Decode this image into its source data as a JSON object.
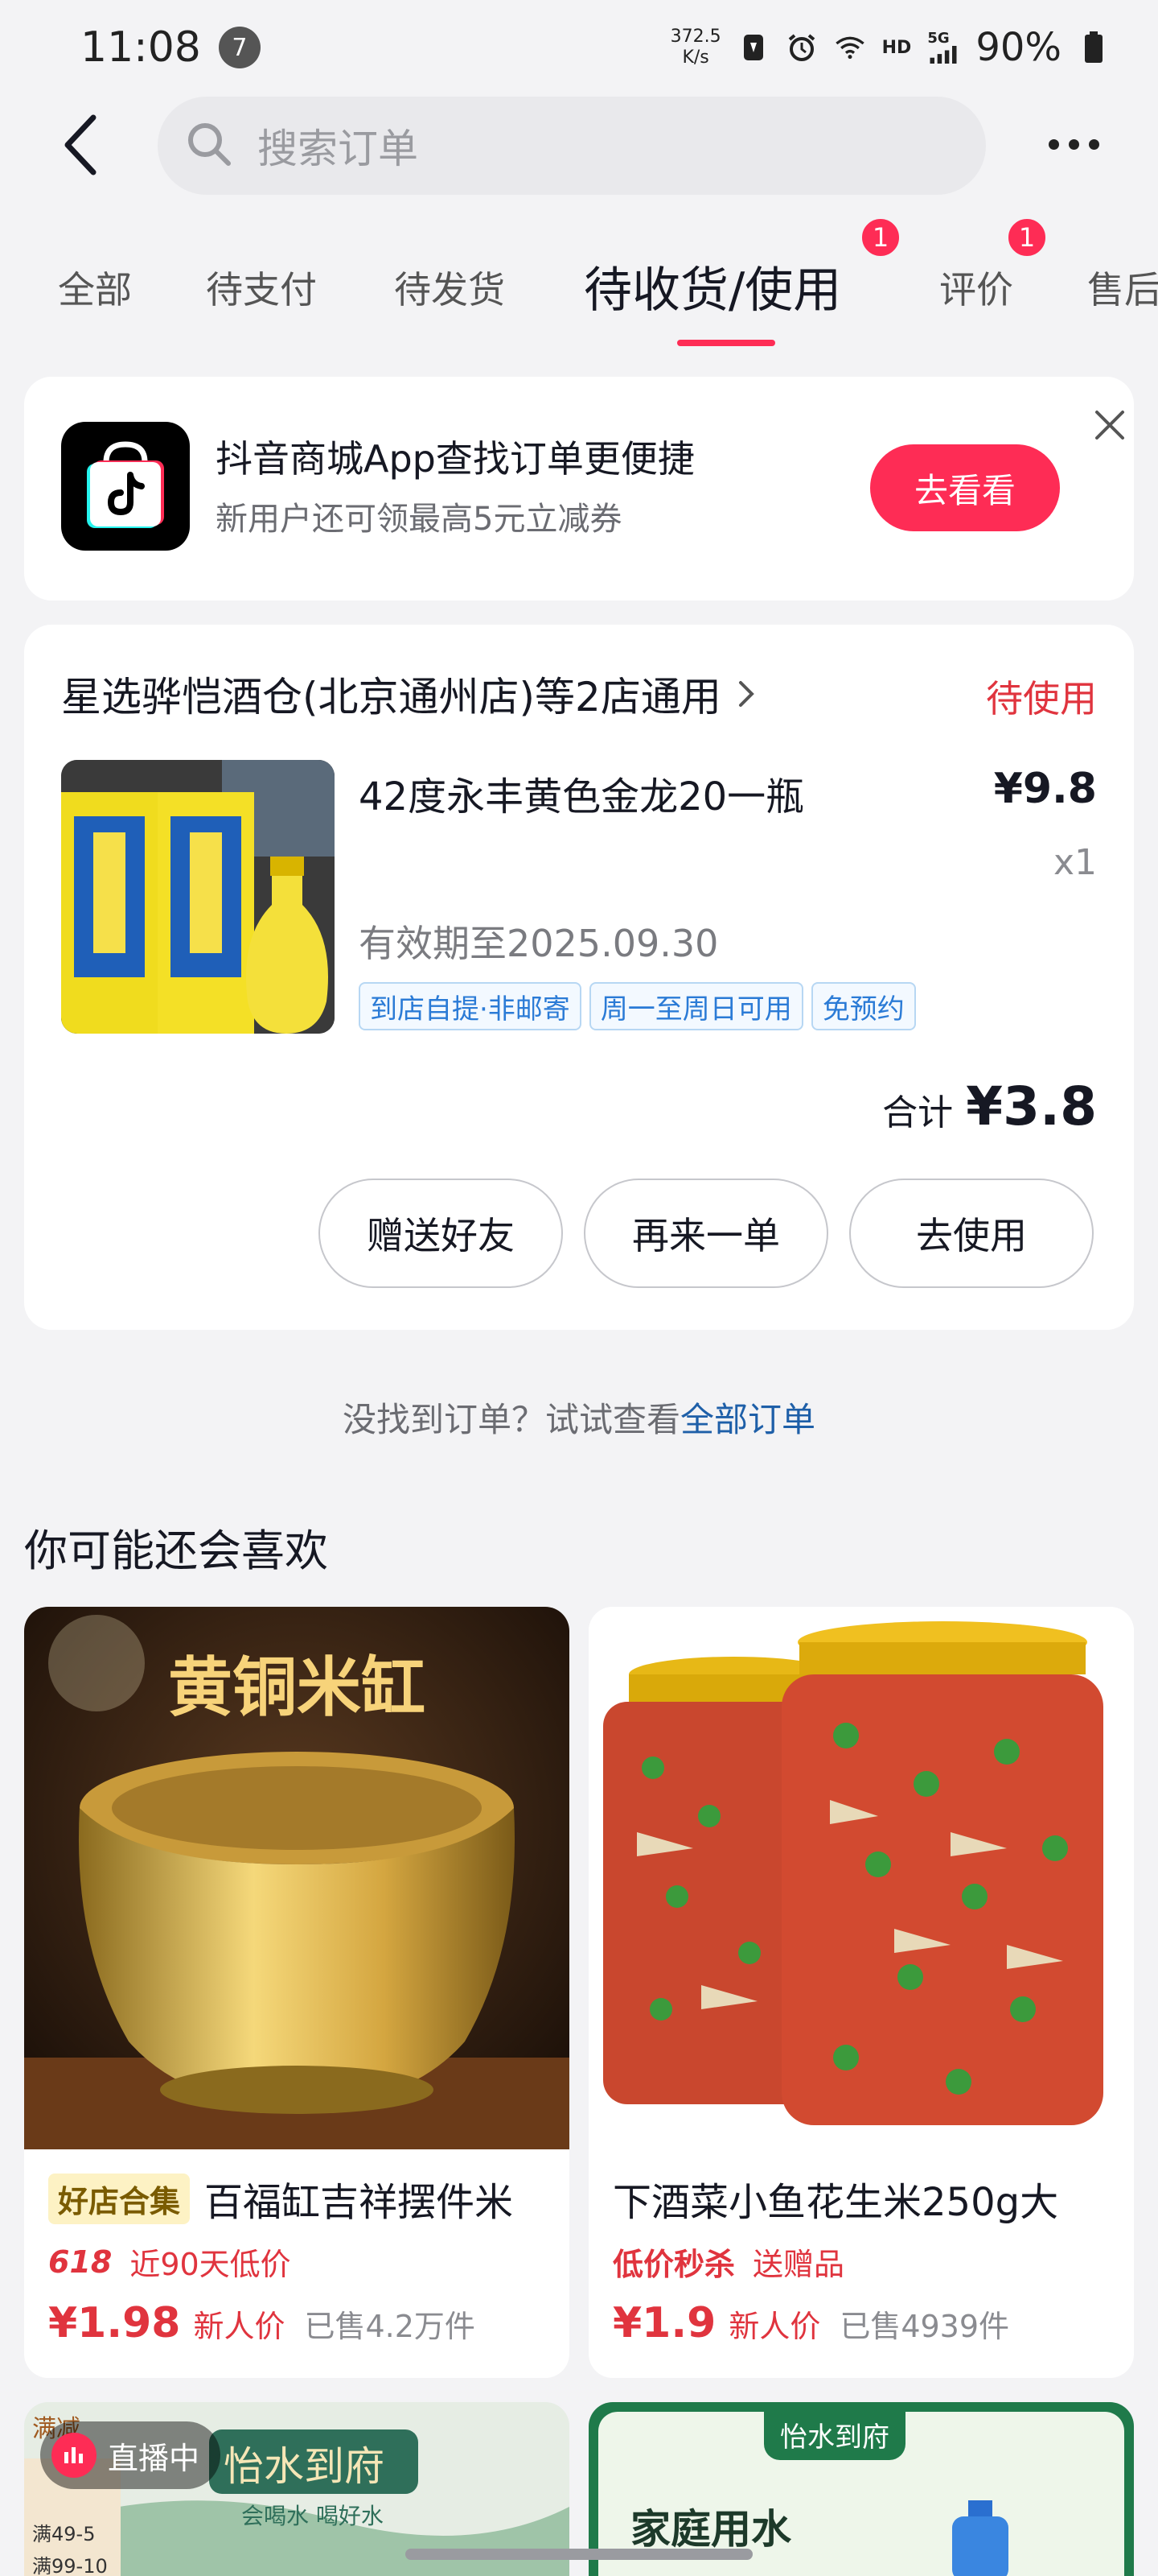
{
  "status_bar": {
    "time": "11:08",
    "notification_count": "7",
    "net_speed_value": "372.5",
    "net_speed_unit": "K/s",
    "hd": "HD",
    "signal": "5G",
    "battery": "90%"
  },
  "search": {
    "placeholder": "搜索订单"
  },
  "tabs": [
    {
      "label": "全部"
    },
    {
      "label": "待支付"
    },
    {
      "label": "待发货"
    },
    {
      "label": "待收货/使用",
      "badge": "1",
      "active": true
    },
    {
      "label": "评价",
      "badge": "1"
    },
    {
      "label": "售后"
    }
  ],
  "promo": {
    "title": "抖音商城App查找订单更便捷",
    "subtitle": "新用户还可领最高5元立减券",
    "button": "去看看"
  },
  "order": {
    "store": "星选骅恺酒仓(北京通州店)等2店通用",
    "status": "待使用",
    "product_name": "42度永丰黄色金龙20一瓶",
    "price": "¥9.8",
    "quantity": "x1",
    "validity": "有效期至2025.09.30",
    "tags": [
      "到店自提·非邮寄",
      "周一至周日可用",
      "免预约"
    ],
    "total_label": "合计",
    "total_value": "¥3.8",
    "buttons": [
      "赠送好友",
      "再来一单",
      "去使用"
    ]
  },
  "hint": {
    "text": "没找到订单？试试查看",
    "link": "全部订单"
  },
  "recommend": {
    "title": "你可能还会喜欢",
    "items": [
      {
        "image_text": "黄铜米缸",
        "badge": "好店合集",
        "name": "百福缸吉祥摆件米",
        "promo_a": "618",
        "promo_b": "近90天低价",
        "price": "¥1.98",
        "new_user": "新人价",
        "sold": "已售4.2万件"
      },
      {
        "badge": "",
        "name": "下酒菜小鱼花生米250g大",
        "promo_a": "低价秒杀",
        "promo_b": "送赠品",
        "price": "¥1.9",
        "new_user": "新人价",
        "sold": "已售4939件"
      }
    ]
  },
  "bottom": {
    "live": "直播中",
    "left_banner": "怡水到府",
    "left_sub": "会喝水 喝好水",
    "left_deal1": "满49-5",
    "left_deal2": "满99-10",
    "left_tag": "满减",
    "right_badge": "怡水到府",
    "right_title": "家庭用水"
  },
  "colors": {
    "accent": "#fe2c55",
    "link": "#1e5fa8",
    "status_red": "#e0343e"
  }
}
